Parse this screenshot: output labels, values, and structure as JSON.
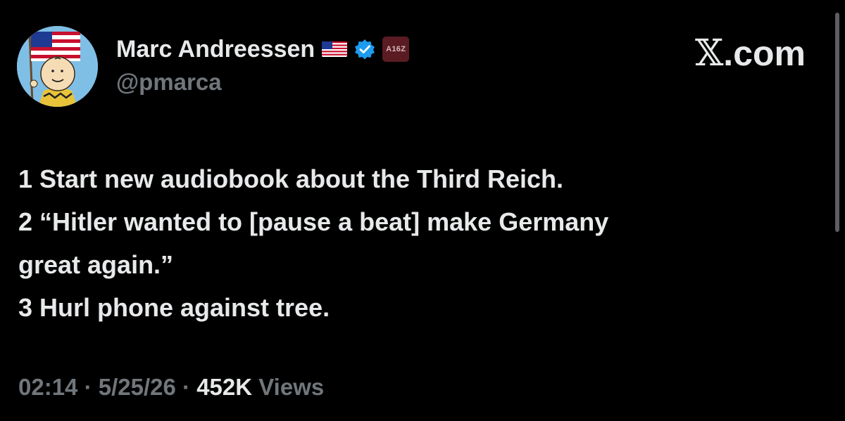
{
  "author": {
    "display_name": "Marc Andreessen",
    "handle": "@pmarca",
    "avatar_icon": "charlie-brown-flag-avatar",
    "flag_icon": "us-flag-emoji",
    "verified_icon": "blue-verified-badge",
    "affiliate_badge": "A16Z"
  },
  "site": {
    "logo_letter": "𝕏",
    "logo_suffix": ".com"
  },
  "tweet": {
    "lines": [
      "1 Start new audiobook about the Third Reich.",
      "2 “Hitler wanted to [pause a beat] make Germany",
      "great again.”",
      "3 Hurl phone against tree."
    ]
  },
  "meta": {
    "time": "02:14",
    "date": "5/25/26",
    "views_count": "452K",
    "views_label": "Views",
    "separator": "·"
  },
  "colors": {
    "background": "#000000",
    "text": "#e7e9ea",
    "muted": "#71767b",
    "verified": "#1d9bf0",
    "affiliate_bg": "#5a1b22"
  }
}
